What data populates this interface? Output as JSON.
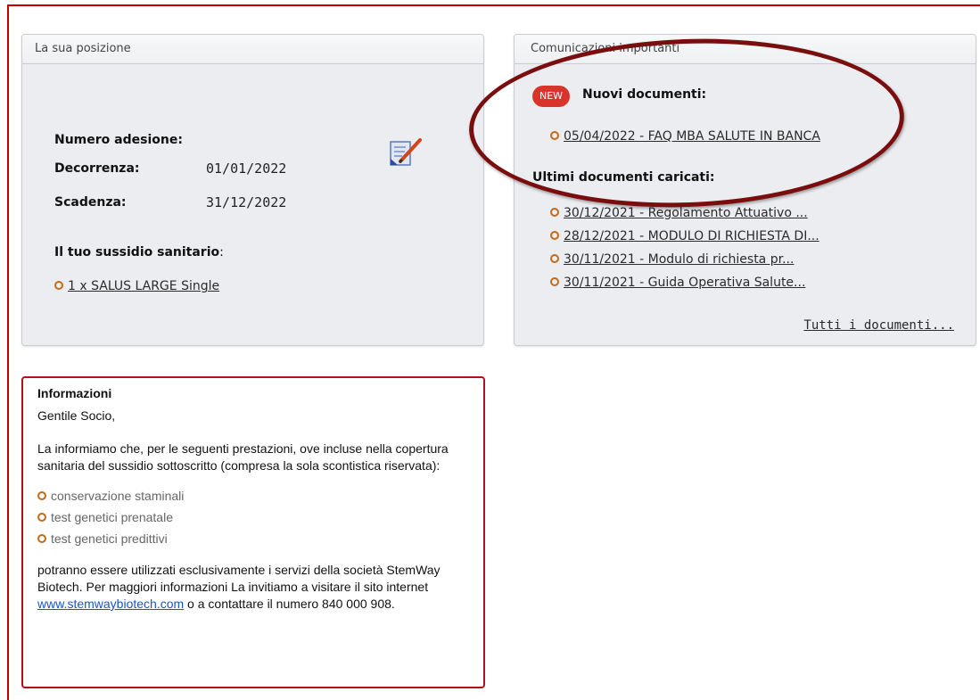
{
  "position_panel": {
    "title": "La sua posizione",
    "membership_label": "Numero adesione:",
    "start_label": "Decorrenza:",
    "start_value": "01/01/2022",
    "end_label": "Scadenza:",
    "end_value": "31/12/2022",
    "subsidy_label": "Il tuo sussidio sanitario",
    "subsidy_label_suffix": ":",
    "subsidy_item": "1 x SALUS LARGE Single",
    "edit_icon": "edit-document-icon"
  },
  "communications_panel": {
    "title": "Comunicazioni importanti",
    "new_badge": "NEW",
    "new_docs_label": "Nuovi documenti:",
    "new_docs": [
      "05/04/2022 - FAQ MBA SALUTE IN BANCA"
    ],
    "latest_docs_label": "Ultimi documenti caricati:",
    "latest_docs": [
      "30/12/2021 - Regolamento Attuativo ...",
      "28/12/2021 - MODULO DI RICHIESTA DI...",
      "30/11/2021 - Modulo di richiesta pr...",
      "30/11/2021 - Guida Operativa Salute..."
    ],
    "all_docs_link": "Tutti i documenti..."
  },
  "info_box": {
    "title": "Informazioni",
    "greeting": "Gentile Socio,",
    "intro": "La informiamo che, per le seguenti prestazioni, ove incluse nella copertura sanitaria del sussidio sottoscritto (compresa la sola scontistica riservata):",
    "items": [
      "conservazione staminali",
      "test genetici prenatale",
      "test genetici predittivi"
    ],
    "body_before_link": "potranno essere utilizzati esclusivamente i servizi della società StemWay Biotech. Per maggiori informazioni La invitiamo a visitare il sito internet ",
    "link_text": "www.stemwaybiotech.com",
    "body_after_link": " o a contattare il numero 840 000 908."
  },
  "colors": {
    "frame": "#c00000",
    "highlight_ellipse": "#7a0d0d",
    "new_badge": "#d9342b",
    "bullet": "#c46a1b",
    "info_border": "#b3111a",
    "link": "#1a56c8"
  }
}
